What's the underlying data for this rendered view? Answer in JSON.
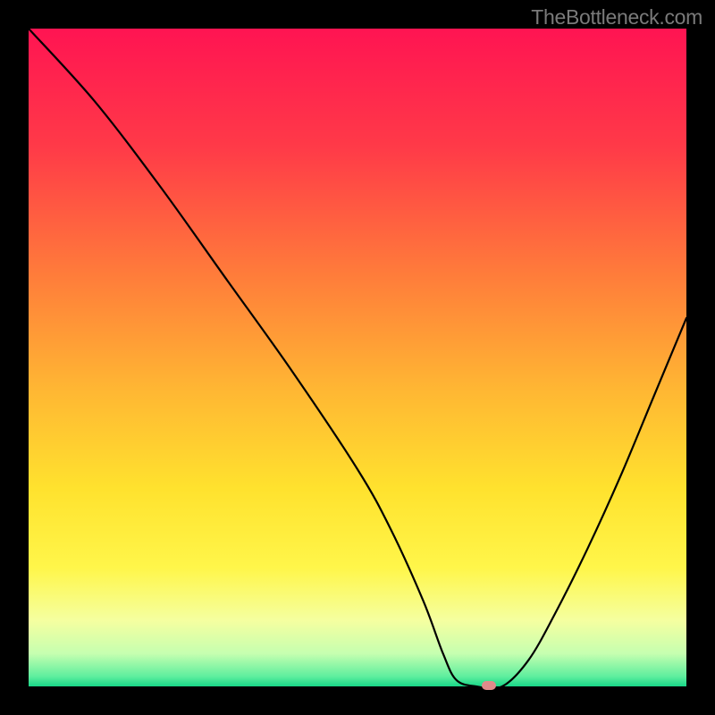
{
  "watermark": "TheBottleneck.com",
  "chart_data": {
    "type": "line",
    "title": "",
    "xlabel": "",
    "ylabel": "",
    "xlim": [
      0,
      100
    ],
    "ylim": [
      0,
      100
    ],
    "series": [
      {
        "name": "bottleneck-curve",
        "x": [
          0,
          10,
          20,
          30,
          40,
          50,
          55,
          60,
          63,
          65,
          68,
          72,
          76,
          80,
          85,
          90,
          95,
          100
        ],
        "values": [
          100,
          89,
          76,
          62,
          48,
          33,
          24,
          13,
          5,
          1,
          0,
          0,
          4,
          11,
          21,
          32,
          44,
          56
        ]
      }
    ],
    "optimal_marker": {
      "x": 70,
      "y": 0
    },
    "gradient_stops": [
      {
        "offset": 0,
        "color": "#ff1452"
      },
      {
        "offset": 0.18,
        "color": "#ff3a48"
      },
      {
        "offset": 0.38,
        "color": "#ff7e3a"
      },
      {
        "offset": 0.55,
        "color": "#ffb733"
      },
      {
        "offset": 0.7,
        "color": "#ffe22e"
      },
      {
        "offset": 0.82,
        "color": "#fff64a"
      },
      {
        "offset": 0.9,
        "color": "#f5ffa0"
      },
      {
        "offset": 0.95,
        "color": "#c6ffb0"
      },
      {
        "offset": 0.985,
        "color": "#5eee9e"
      },
      {
        "offset": 1.0,
        "color": "#18d788"
      }
    ]
  }
}
